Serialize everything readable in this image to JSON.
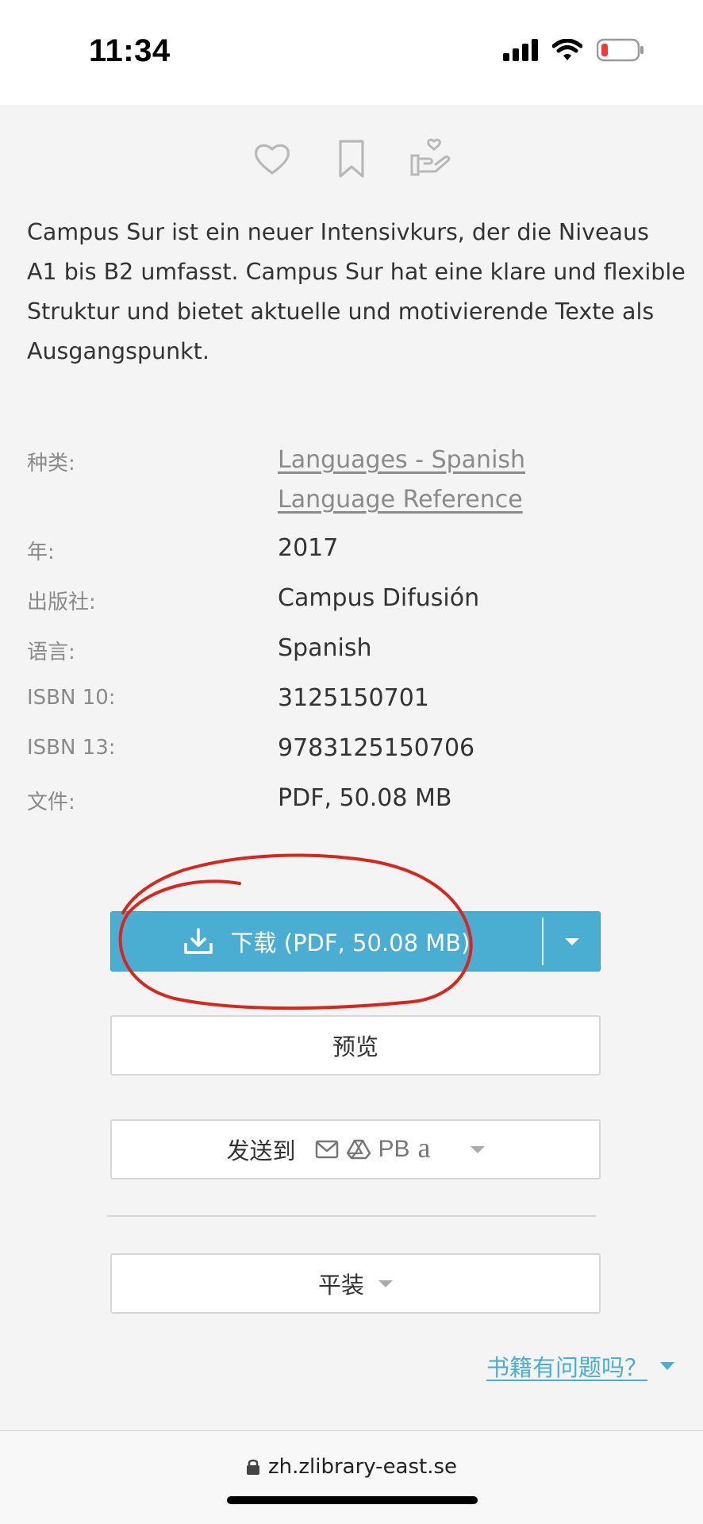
{
  "status_bar": {
    "time": "11:34"
  },
  "description": "Campus Sur ist ein neuer Intensivkurs, der die Niveaus A1 bis B2 umfasst. Campus Sur hat eine klare und flexible Struktur und bietet aktuelle und motivierende Texte als Ausgangspunkt.",
  "properties": {
    "category_label": "种类:",
    "category_values": [
      "Languages - Spanish",
      "Language Reference"
    ],
    "year_label": "年:",
    "year_value": "2017",
    "publisher_label": "出版社:",
    "publisher_value": "Campus Difusión",
    "language_label": "语言:",
    "language_value": "Spanish",
    "isbn10_label": "ISBN 10:",
    "isbn10_value": "3125150701",
    "isbn13_label": "ISBN 13:",
    "isbn13_value": "9783125150706",
    "file_label": "文件:",
    "file_value": "PDF, 50.08 MB"
  },
  "buttons": {
    "download_label": "下载 (PDF, 50.08 MB)",
    "preview_label": "预览",
    "send_label": "发送到",
    "send_pb": "PB",
    "send_amazon": "a",
    "paperback_label": "平装"
  },
  "problem_link": "书籍有问题吗？",
  "url_bar": {
    "url": "zh.zlibrary-east.se"
  },
  "colors": {
    "accent": "#49aed2",
    "annotation": "#d8261c"
  }
}
